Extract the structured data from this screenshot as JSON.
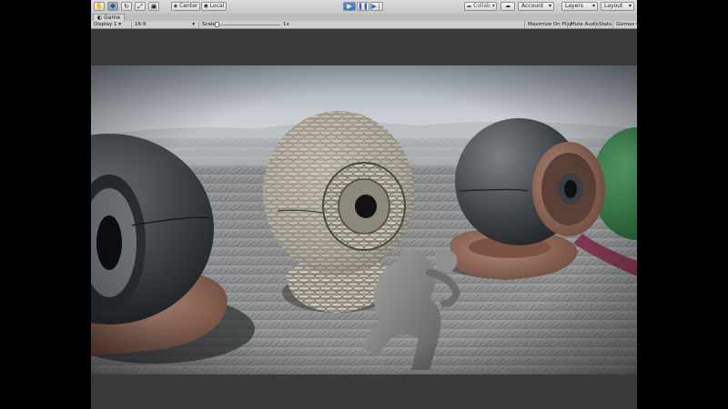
{
  "toolbar": {
    "tools": [
      {
        "name": "hand-tool",
        "icon": "hand-icon",
        "glyph": "✋"
      },
      {
        "name": "move-tool",
        "icon": "move-icon",
        "glyph": "✥"
      },
      {
        "name": "rotate-tool",
        "icon": "rotate-icon",
        "glyph": "↻"
      },
      {
        "name": "scale-tool",
        "icon": "scale-icon",
        "glyph": "⤢"
      },
      {
        "name": "rect-tool",
        "icon": "rect-tool-icon",
        "glyph": "▣"
      }
    ],
    "pivot_label": "Center",
    "space_label": "Local",
    "collab_label": "Collab",
    "account_label": "Account",
    "layers_label": "Layers",
    "layout_label": "Layout"
  },
  "tab": {
    "title": "Game"
  },
  "gamebar": {
    "display": "Display 1",
    "aspect": "16:9",
    "scale_label": "Scale",
    "scale_value": "1x",
    "maximize": "Maximize On Play",
    "mute": "Mute Audio",
    "stats": "Stats",
    "gizmos": "Gizmos"
  },
  "colors": {
    "play_active": "#3f74c0",
    "toolbar_bg": "#c6c6c6",
    "editor_bg": "#3a3a3a",
    "floor": "#8e9092",
    "sky": "#c7ccd2"
  }
}
